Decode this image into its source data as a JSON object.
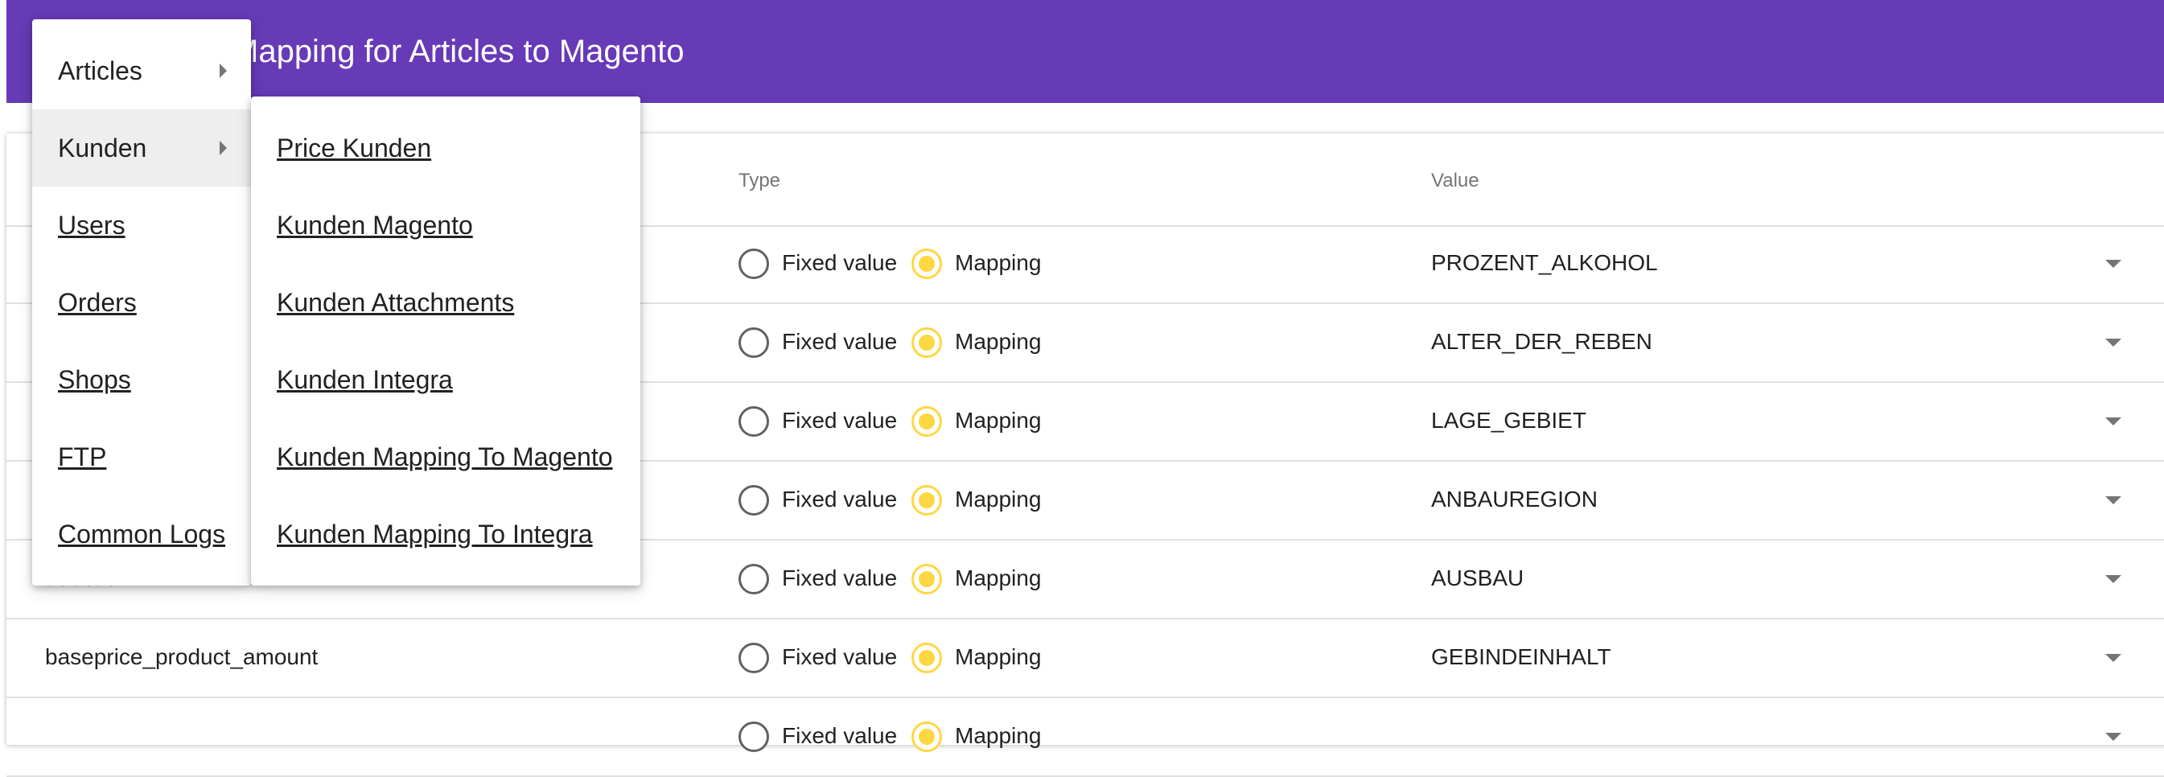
{
  "header": {
    "title": "Mapping for Articles to Magento"
  },
  "table": {
    "columns": {
      "type": "Type",
      "value": "Value"
    },
    "rows": [
      {
        "field": "",
        "fixed_label": "Fixed value",
        "mapping_label": "Mapping",
        "value": "PROZENT_ALKOHOL"
      },
      {
        "field": "",
        "fixed_label": "Fixed value",
        "mapping_label": "Mapping",
        "value": "ALTER_DER_REBEN"
      },
      {
        "field": "",
        "fixed_label": "Fixed value",
        "mapping_label": "Mapping",
        "value": "LAGE_GEBIET"
      },
      {
        "field": "",
        "fixed_label": "Fixed value",
        "mapping_label": "Mapping",
        "value": "ANBAUREGION"
      },
      {
        "field": "ausbau",
        "fixed_label": "Fixed value",
        "mapping_label": "Mapping",
        "value": "AUSBAU"
      },
      {
        "field": "baseprice_product_amount",
        "fixed_label": "Fixed value",
        "mapping_label": "Mapping",
        "value": "GEBINDEINHALT"
      },
      {
        "field": "",
        "fixed_label": "Fixed value",
        "mapping_label": "Mapping",
        "value": ""
      }
    ]
  },
  "menu": {
    "items": [
      {
        "label": "Articles"
      },
      {
        "label": "Kunden"
      },
      {
        "label": "Users"
      },
      {
        "label": "Orders"
      },
      {
        "label": "Shops"
      },
      {
        "label": "FTP"
      },
      {
        "label": "Common Logs"
      }
    ],
    "submenu": [
      {
        "label": "Price Kunden"
      },
      {
        "label": "Kunden Magento"
      },
      {
        "label": "Kunden Attachments"
      },
      {
        "label": "Kunden Integra"
      },
      {
        "label": "Kunden Mapping To Magento"
      },
      {
        "label": "Kunden Mapping To Integra"
      }
    ]
  },
  "colors": {
    "primary": "#673ab7",
    "accent": "#ffd740"
  }
}
